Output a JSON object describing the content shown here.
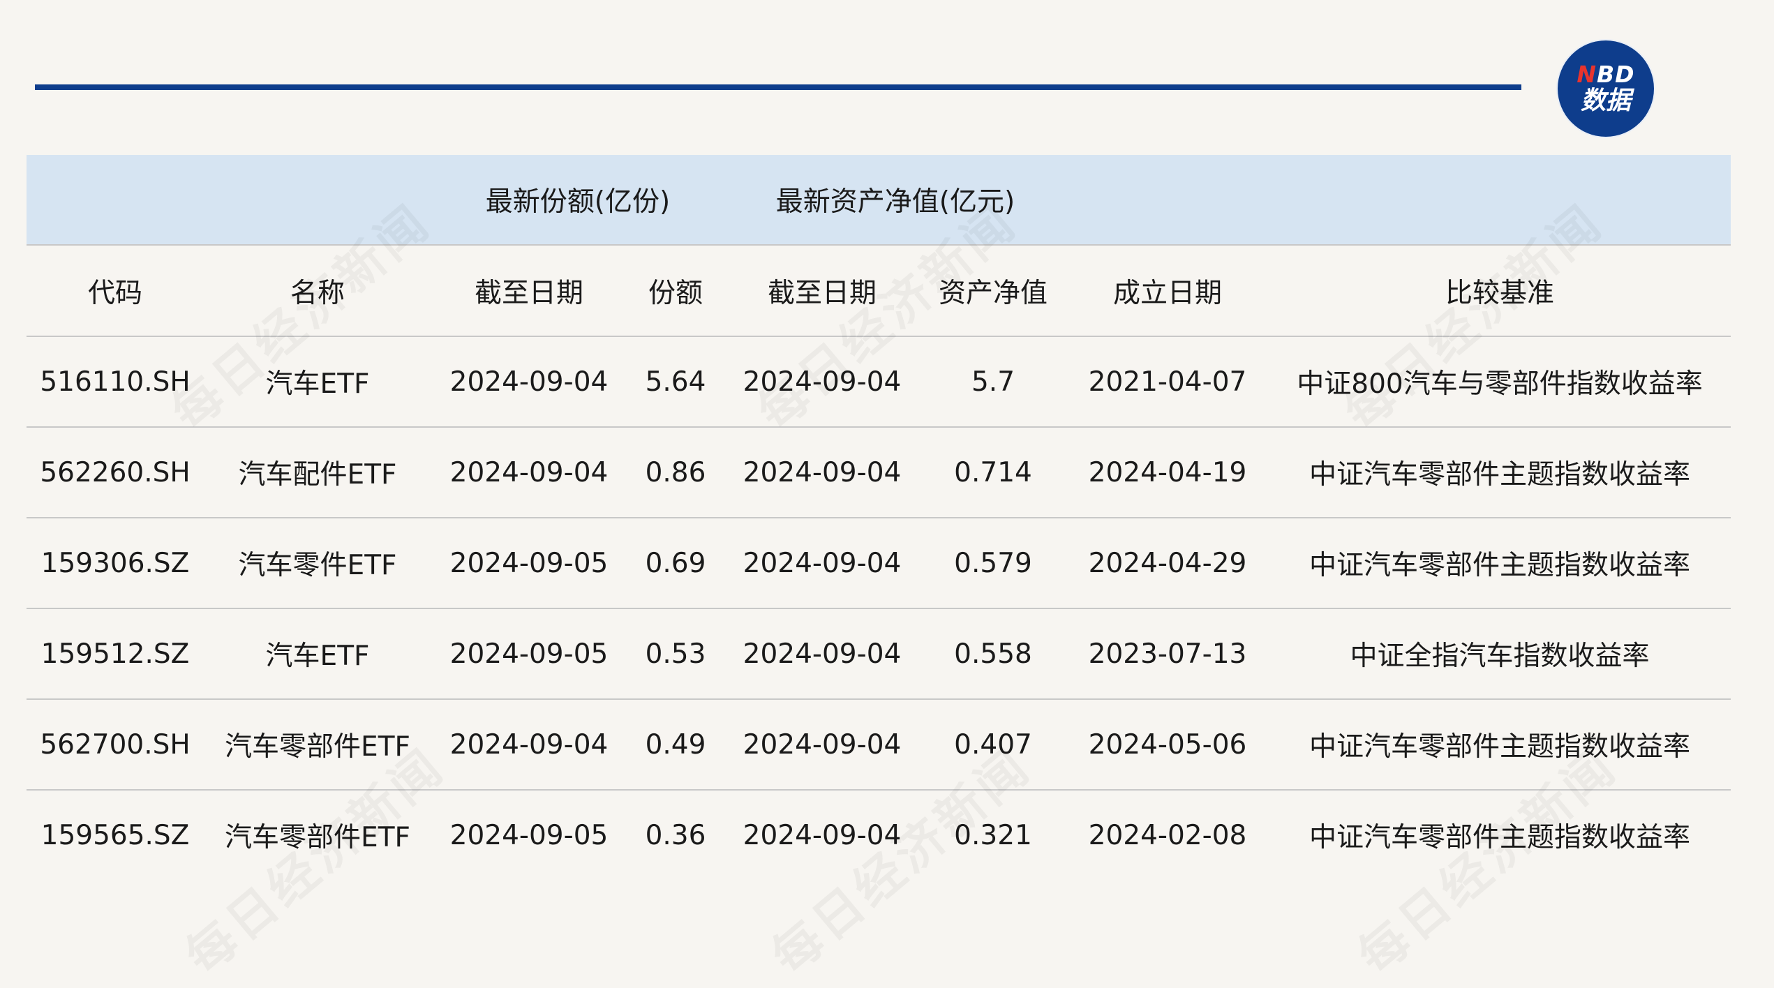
{
  "logo": {
    "line1_n": "N",
    "line1_rest": "BD",
    "line2": "数据"
  },
  "watermark": "每日经济新闻",
  "table": {
    "group_headers": {
      "shares": "最新份额(亿份)",
      "nav": "最新资产净值(亿元)"
    },
    "columns": [
      "代码",
      "名称",
      "截至日期",
      "份额",
      "截至日期",
      "资产净值",
      "成立日期",
      "比较基准"
    ],
    "rows": [
      [
        "516110.SH",
        "汽车ETF",
        "2024-09-04",
        "5.64",
        "2024-09-04",
        "5.7",
        "2021-04-07",
        "中证800汽车与零部件指数收益率"
      ],
      [
        "562260.SH",
        "汽车配件ETF",
        "2024-09-04",
        "0.86",
        "2024-09-04",
        "0.714",
        "2024-04-19",
        "中证汽车零部件主题指数收益率"
      ],
      [
        "159306.SZ",
        "汽车零件ETF",
        "2024-09-05",
        "0.69",
        "2024-09-04",
        "0.579",
        "2024-04-29",
        "中证汽车零部件主题指数收益率"
      ],
      [
        "159512.SZ",
        "汽车ETF",
        "2024-09-05",
        "0.53",
        "2024-09-04",
        "0.558",
        "2023-07-13",
        "中证全指汽车指数收益率"
      ],
      [
        "562700.SH",
        "汽车零部件ETF",
        "2024-09-04",
        "0.49",
        "2024-09-04",
        "0.407",
        "2024-05-06",
        "中证汽车零部件主题指数收益率"
      ],
      [
        "159565.SZ",
        "汽车零部件ETF",
        "2024-09-05",
        "0.36",
        "2024-09-04",
        "0.321",
        "2024-02-08",
        "中证汽车零部件主题指数收益率"
      ]
    ]
  },
  "colors": {
    "accent": "#0e3d8c",
    "header_bg": "#d6e4f2",
    "logo_red": "#e8342e",
    "background": "#f7f5f1"
  }
}
